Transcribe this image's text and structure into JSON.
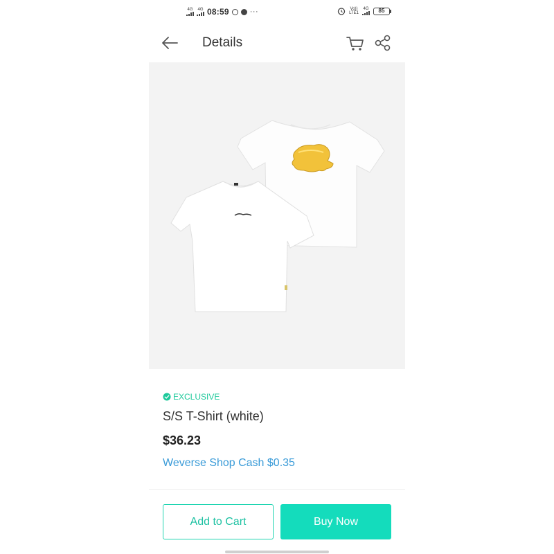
{
  "status_bar": {
    "network_1": "4G",
    "network_2": "4G",
    "time": "08:59",
    "more": "···",
    "volte_line1": "Vo))",
    "volte_line2": "LTE1",
    "network_3": "4G",
    "battery": "85"
  },
  "header": {
    "title": "Details"
  },
  "product": {
    "badge": "EXCLUSIVE",
    "name": "S/S T-Shirt (white)",
    "price": "$36.23",
    "cash": "Weverse Shop Cash $0.35"
  },
  "actions": {
    "add_to_cart": "Add to Cart",
    "buy_now": "Buy Now"
  },
  "colors": {
    "accent": "#14dcbc",
    "exclusive": "#1dc99b",
    "cash_link": "#3a9bd8"
  },
  "icons": [
    "back-arrow-icon",
    "cart-icon",
    "share-icon",
    "check-circle-icon",
    "alarm-icon",
    "battery-icon"
  ]
}
